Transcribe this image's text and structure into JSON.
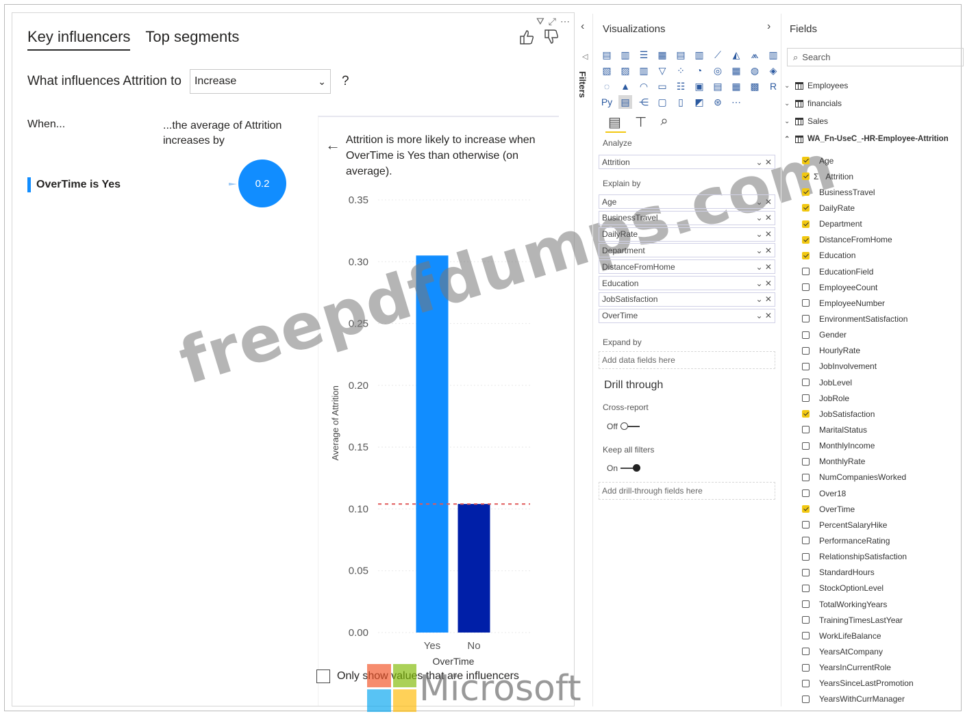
{
  "visual": {
    "tabs": [
      {
        "label": "Key influencers",
        "active": true
      },
      {
        "label": "Top segments",
        "active": false
      }
    ],
    "question": {
      "label": "What influences Attrition to",
      "selected": "Increase",
      "help": "?"
    },
    "when_label": "When...",
    "avg_label": "...the average of Attrition increases by",
    "influencer": {
      "label": "OverTime is Yes",
      "value": "0.2"
    },
    "detail_text": "Attrition is more likely to increase when OverTime is Yes than otherwise (on average).",
    "only_show_label": "Only show values that are influencers",
    "only_show_checked": false
  },
  "chart_data": {
    "type": "bar",
    "categories": [
      "Yes",
      "No"
    ],
    "values": [
      0.305,
      0.104
    ],
    "colors": [
      "#118dff",
      "#001fa8"
    ],
    "reference_line": 0.104,
    "xlabel": "OverTime",
    "ylabel": "Average of Attrition",
    "ylim": [
      0,
      0.35
    ],
    "yticks": [
      "0.00",
      "0.05",
      "0.10",
      "0.15",
      "0.20",
      "0.25",
      "0.30",
      "0.35"
    ],
    "grid": true
  },
  "watermark": {
    "text": "freepdfdumps.com",
    "brand": "Microsoft"
  },
  "viz_pane": {
    "filters_label": "Filters",
    "title": "Visualizations",
    "analyze_label": "Analyze",
    "analyze_field": "Attrition",
    "explain_label": "Explain by",
    "explain_fields": [
      "Age",
      "BusinessTravel",
      "DailyRate",
      "Department",
      "DistanceFromHome",
      "Education",
      "JobSatisfaction",
      "OverTime"
    ],
    "expand_label": "Expand by",
    "expand_placeholder": "Add data fields here",
    "drill_title": "Drill through",
    "cross_report_label": "Cross-report",
    "cross_report_state": "Off",
    "keep_filters_label": "Keep all filters",
    "keep_filters_state": "On",
    "drill_placeholder": "Add drill-through fields here"
  },
  "fields_pane": {
    "title": "Fields",
    "search_placeholder": "Search",
    "tables": [
      "Employees",
      "financials",
      "Sales",
      "WA_Fn-UseC_-HR-Employee-Attrition"
    ],
    "fields": [
      {
        "name": "Age",
        "checked": true
      },
      {
        "name": "Attrition",
        "checked": true,
        "sigma": true
      },
      {
        "name": "BusinessTravel",
        "checked": true
      },
      {
        "name": "DailyRate",
        "checked": true
      },
      {
        "name": "Department",
        "checked": true
      },
      {
        "name": "DistanceFromHome",
        "checked": true
      },
      {
        "name": "Education",
        "checked": true
      },
      {
        "name": "EducationField",
        "checked": false
      },
      {
        "name": "EmployeeCount",
        "checked": false
      },
      {
        "name": "EmployeeNumber",
        "checked": false
      },
      {
        "name": "EnvironmentSatisfaction",
        "checked": false
      },
      {
        "name": "Gender",
        "checked": false
      },
      {
        "name": "HourlyRate",
        "checked": false
      },
      {
        "name": "JobInvolvement",
        "checked": false
      },
      {
        "name": "JobLevel",
        "checked": false
      },
      {
        "name": "JobRole",
        "checked": false
      },
      {
        "name": "JobSatisfaction",
        "checked": true
      },
      {
        "name": "MaritalStatus",
        "checked": false
      },
      {
        "name": "MonthlyIncome",
        "checked": false
      },
      {
        "name": "MonthlyRate",
        "checked": false
      },
      {
        "name": "NumCompaniesWorked",
        "checked": false
      },
      {
        "name": "Over18",
        "checked": false
      },
      {
        "name": "OverTime",
        "checked": true
      },
      {
        "name": "PercentSalaryHike",
        "checked": false
      },
      {
        "name": "PerformanceRating",
        "checked": false
      },
      {
        "name": "RelationshipSatisfaction",
        "checked": false
      },
      {
        "name": "StandardHours",
        "checked": false
      },
      {
        "name": "StockOptionLevel",
        "checked": false
      },
      {
        "name": "TotalWorkingYears",
        "checked": false
      },
      {
        "name": "TrainingTimesLastYear",
        "checked": false
      },
      {
        "name": "WorkLifeBalance",
        "checked": false
      },
      {
        "name": "YearsAtCompany",
        "checked": false
      },
      {
        "name": "YearsInCurrentRole",
        "checked": false
      },
      {
        "name": "YearsSinceLastPromotion",
        "checked": false
      },
      {
        "name": "YearsWithCurrManager",
        "checked": false
      }
    ]
  }
}
